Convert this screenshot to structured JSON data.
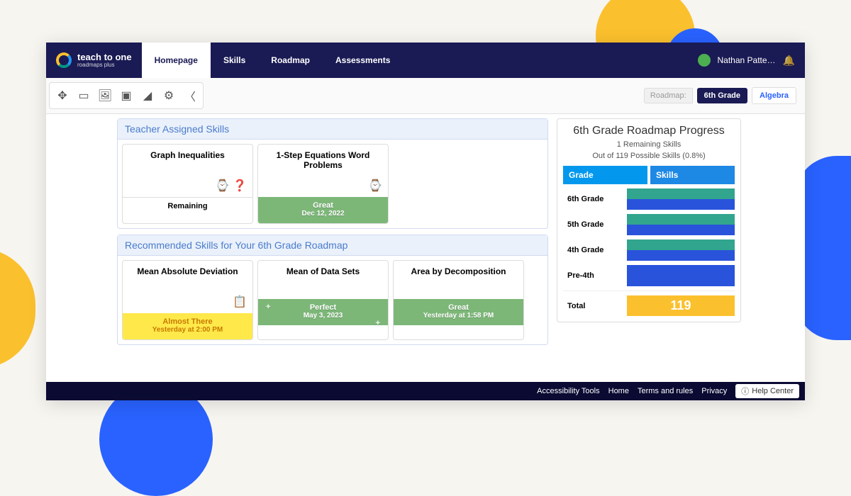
{
  "brand": {
    "name": "teach to one",
    "sub": "roadmaps plus"
  },
  "nav": {
    "tabs": [
      "Homepage",
      "Skills",
      "Roadmap",
      "Assessments"
    ],
    "user": "Nathan Patte…"
  },
  "roadmap_selector": {
    "label": "Roadmap:",
    "active": "6th Grade",
    "other": "Algebra"
  },
  "sections": {
    "assigned": {
      "title": "Teacher Assigned Skills",
      "cards": [
        {
          "title": "Graph Inequalities",
          "status": "Remaining",
          "date": "",
          "style": "plain",
          "icons": "⌚ ❓"
        },
        {
          "title": "1-Step Equations Word Problems",
          "status": "Great",
          "date": "Dec 12, 2022",
          "style": "green",
          "icons": "⌚"
        }
      ]
    },
    "recommended": {
      "title": "Recommended Skills for Your 6th Grade Roadmap",
      "cards": [
        {
          "title": "Mean Absolute Deviation",
          "status": "Almost There",
          "date": "Yesterday at 2:00 PM",
          "style": "yellow",
          "icons": "📋"
        },
        {
          "title": "Mean of Data Sets",
          "status": "Perfect",
          "date": "May 3, 2023",
          "style": "green sparkle",
          "icons": ""
        },
        {
          "title": "Area by Decomposition",
          "status": "Great",
          "date": "Yesterday at 1:58 PM",
          "style": "green",
          "icons": ""
        }
      ]
    }
  },
  "progress": {
    "title": "6th Grade Roadmap Progress",
    "remaining": "1 Remaining Skills",
    "outof": "Out of 119 Possible Skills (0.8%)",
    "headers": {
      "grade": "Grade",
      "skills": "Skills"
    },
    "rows": [
      {
        "grade": "6th Grade"
      },
      {
        "grade": "5th Grade"
      },
      {
        "grade": "4th Grade"
      },
      {
        "grade": "Pre-4th"
      }
    ],
    "total_label": "Total",
    "total_value": "119"
  },
  "footer": {
    "links": [
      "Accessibility Tools",
      "Home",
      "Terms and rules",
      "Privacy"
    ],
    "help": "Help Center"
  }
}
